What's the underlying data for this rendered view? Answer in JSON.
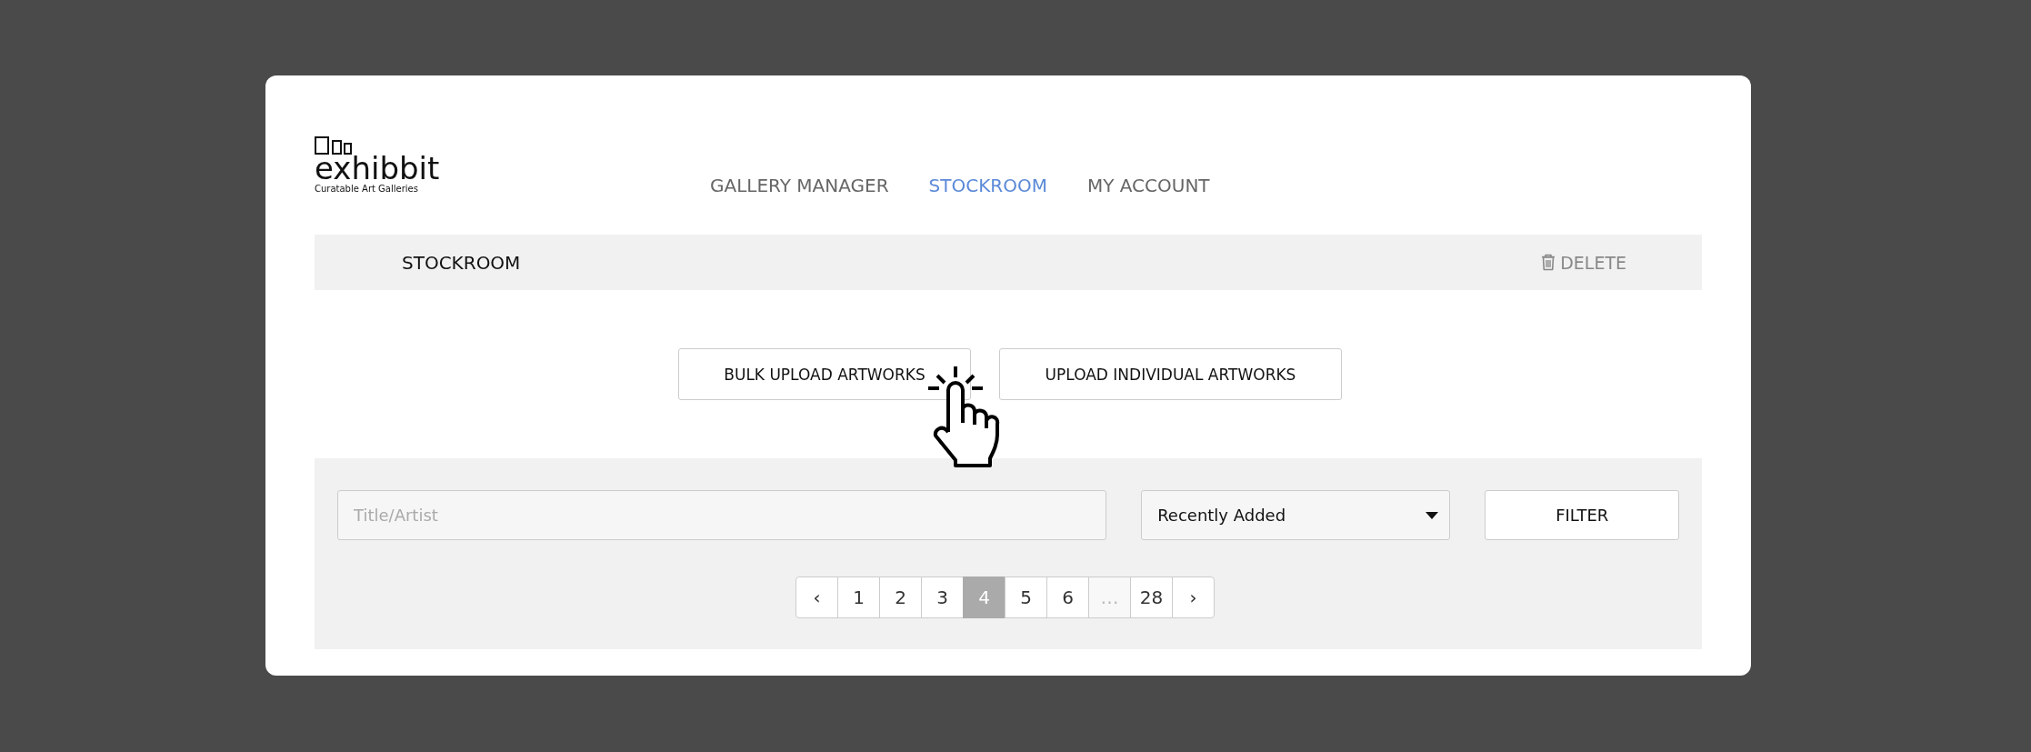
{
  "logo": {
    "name": "exhibbit",
    "tagline": "Curatable Art Galleries"
  },
  "nav": [
    {
      "label": "GALLERY MANAGER",
      "selected": false
    },
    {
      "label": "STOCKROOM",
      "selected": true
    },
    {
      "label": "MY ACCOUNT",
      "selected": false
    }
  ],
  "section_bar": {
    "title": "STOCKROOM",
    "delete_label": "DELETE"
  },
  "upload_buttons": [
    "BULK UPLOAD ARTWORKS",
    "UPLOAD INDIVIDUAL ARTWORKS"
  ],
  "search": {
    "placeholder": "Title/Artist"
  },
  "sort": {
    "value": "Recently Added"
  },
  "filter_button": "FILTER",
  "pagination": [
    {
      "kind": "prev",
      "label": "‹"
    },
    {
      "kind": "page",
      "label": "1",
      "selected": false
    },
    {
      "kind": "page",
      "label": "2",
      "selected": false
    },
    {
      "kind": "page",
      "label": "3",
      "selected": false
    },
    {
      "kind": "page",
      "label": "4",
      "selected": true
    },
    {
      "kind": "page",
      "label": "5",
      "selected": false
    },
    {
      "kind": "page",
      "label": "6",
      "selected": false
    },
    {
      "kind": "ellipsis",
      "label": "…"
    },
    {
      "kind": "page",
      "label": "28",
      "selected": false
    },
    {
      "kind": "next",
      "label": "›"
    }
  ]
}
